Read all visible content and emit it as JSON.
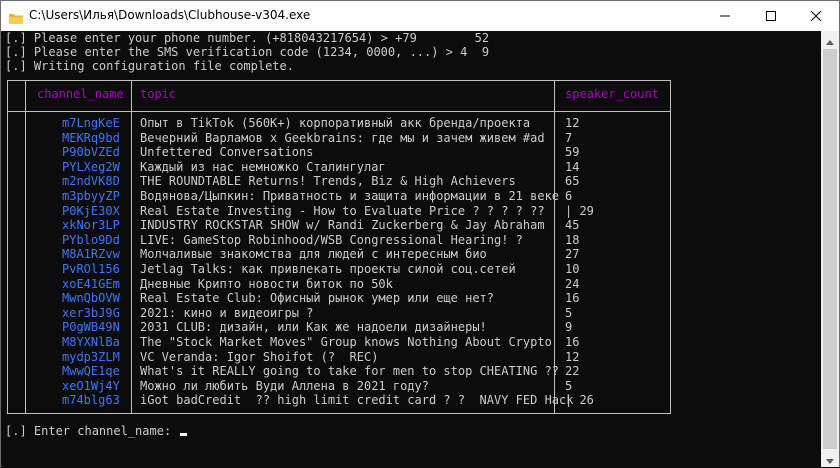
{
  "window": {
    "title": "C:\\Users\\Илья\\Downloads\\Clubhouse-v304.exe",
    "app_icon": "folder-icon",
    "controls": [
      "minimize-icon",
      "maximize-icon",
      "close-icon"
    ]
  },
  "console": {
    "lines": [
      "[.] Please enter your phone number. (+818043217654) > +79        52",
      "[.] Please enter the SMS verification code (1234, 0000, ...) > 4  9",
      "[.] Writing configuration file complete."
    ],
    "prompt": "[.] Enter channel_name: "
  },
  "table": {
    "headers": [
      "channel_name",
      "topic",
      "speaker_count"
    ],
    "header_color": "#b000c8",
    "channel_color": "#3b78ff",
    "rows": [
      {
        "channel_name": "m7LngKeE",
        "topic": "Опыт в TikTok (560K+) корпоративный акк бренда/проекта",
        "speaker_count": "12"
      },
      {
        "channel_name": "MEKRq9bd",
        "topic": "Вечерний Варламов x Geekbrains: где мы и зачем живем #ad",
        "speaker_count": "7"
      },
      {
        "channel_name": "P90bVZEd",
        "topic": "Unfettered Conversations",
        "speaker_count": "59"
      },
      {
        "channel_name": "PYLXeg2W",
        "topic": "Каждый из нас немножко Сталингулаг",
        "speaker_count": "14"
      },
      {
        "channel_name": "m2ndVK8D",
        "topic": "THE ROUNDTABLE Returns! Trends, Biz & High Achievers",
        "speaker_count": "65"
      },
      {
        "channel_name": "m3pbyyZP",
        "topic": "Водянова/Цыпкин: Приватность и защита информации в 21 веке",
        "speaker_count": "6"
      },
      {
        "channel_name": "P0KjE30X",
        "topic": "Real Estate Investing - How to Evaluate Price ? ? ? ? ??",
        "speaker_count": "| 29"
      },
      {
        "channel_name": "xkNor3LP",
        "topic": "INDUSTRY ROCKSTAR SHOW w/ Randi Zuckerberg & Jay Abraham",
        "speaker_count": "45"
      },
      {
        "channel_name": "PYblo9Dd",
        "topic": "LIVE: GameStop Robinhood/WSB Congressional Hearing! ?",
        "speaker_count": "18"
      },
      {
        "channel_name": "M8A1RZvw",
        "topic": "Молчаливые знакомства для людей с интересным био",
        "speaker_count": "27"
      },
      {
        "channel_name": "PvROl156",
        "topic": "Jetlag Talks: как привлекать проекты силой соц.сетей",
        "speaker_count": "10"
      },
      {
        "channel_name": "xoE41GEm",
        "topic": "Дневные Крипто новости биток по 50k",
        "speaker_count": "24"
      },
      {
        "channel_name": "MwnQbOVW",
        "topic": "Real Estate Club: Офисный рынок умер или еще нет?",
        "speaker_count": "16"
      },
      {
        "channel_name": "xer3bJ9G",
        "topic": "2021: кино и видеоигры ?",
        "speaker_count": "5"
      },
      {
        "channel_name": "P0gWB49N",
        "topic": "2031 CLUB: дизайн, или Как же надоели дизайнеры!",
        "speaker_count": "9"
      },
      {
        "channel_name": "M8YXNlBa",
        "topic": "The \"Stock Market Moves\" Group knows Nothing About Crypto",
        "speaker_count": "16"
      },
      {
        "channel_name": "mydp3ZLM",
        "topic": "VC Veranda: Igor Shoifot (?  REC)",
        "speaker_count": "12"
      },
      {
        "channel_name": "MwwQE1qe",
        "topic": "What's it REALLY going to take for men to stop CHEATING ??",
        "speaker_count": "22"
      },
      {
        "channel_name": "xeO1Wj4Y",
        "topic": "Можно ли любить Вуди Аллена в 2021 году?",
        "speaker_count": "5"
      },
      {
        "channel_name": "m74blg63",
        "topic": "iGot badCredit  ?? high limit credit card ? ?  NAVY FED Hack",
        "speaker_count": "| 26"
      }
    ]
  }
}
